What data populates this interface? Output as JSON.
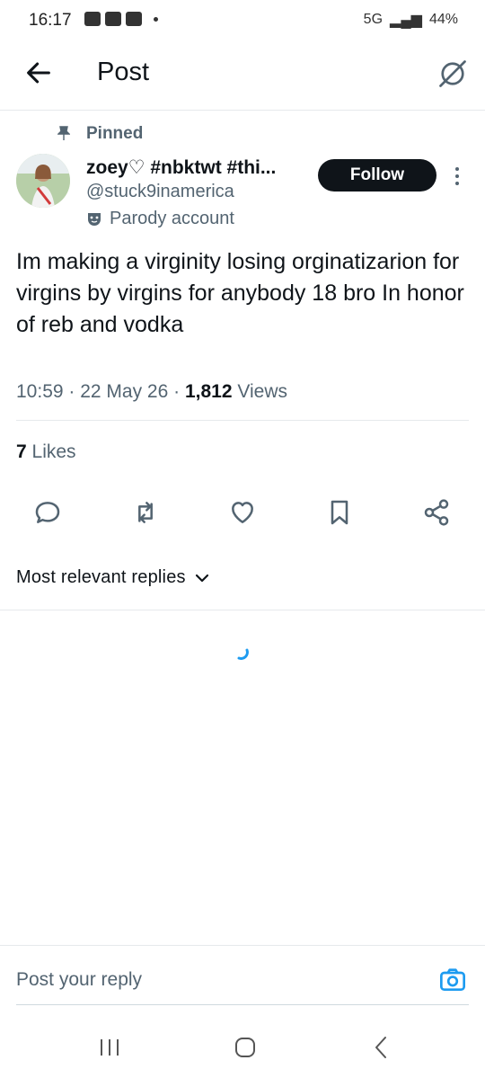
{
  "status_bar": {
    "time": "16:17",
    "battery": "44%",
    "network": "5G"
  },
  "header": {
    "title": "Post",
    "back_icon": "arrow-left-icon",
    "grok_icon": "grok-icon"
  },
  "post": {
    "pinned_label": "Pinned",
    "author_name": "zoey♡ #nbktwt #thi...",
    "handle": "@stuck9inamerica",
    "parody_label": "Parody account",
    "follow_label": "Follow",
    "text": "Im making a virginity losing orginatizarion for virgins by virgins for anybody 18 bro In honor of reb and vodka",
    "time": "10:59",
    "date": "22 May 26",
    "views_count": "1,812",
    "views_label": "Views",
    "likes_count": "7",
    "likes_label": "Likes"
  },
  "actions": [
    "reply-icon",
    "repost-icon",
    "like-icon",
    "bookmark-icon",
    "share-icon"
  ],
  "replies": {
    "sort_label": "Most relevant replies"
  },
  "composer": {
    "placeholder": "Post your reply"
  },
  "colors": {
    "accent": "#1d9bf0",
    "text": "#0f1419",
    "secondary": "#536471"
  }
}
